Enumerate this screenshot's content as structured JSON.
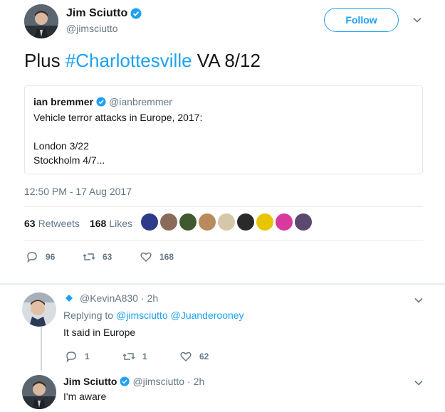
{
  "tweet": {
    "author_name": "Jim Sciutto",
    "author_handle": "@jimsciutto",
    "follow_label": "Follow",
    "text_prefix": "Plus ",
    "hashtag": "#Charlottesville",
    "text_suffix": " VA 8/12",
    "timestamp": "12:50 PM - 17 Aug 2017"
  },
  "quoted": {
    "author_name": "ian bremmer",
    "author_handle": "@ianbremmer",
    "lines": [
      "Vehicle terror attacks in Europe, 2017:",
      "London 3/22",
      "Stockholm 4/7..."
    ]
  },
  "stats": {
    "retweets_count": "63",
    "retweets_label": "Retweets",
    "likes_count": "168",
    "likes_label": "Likes"
  },
  "actions": {
    "replies": "96",
    "retweets": "63",
    "likes": "168"
  },
  "replies": [
    {
      "author_handle": "@KevinA830",
      "time": "2h",
      "replying_prefix": "Replying to",
      "replying_to_1": "@jimsciutto",
      "replying_to_2": "@Juanderooney",
      "text": "It said in Europe",
      "replies": "1",
      "retweets": "1",
      "likes": "62"
    },
    {
      "author_name": "Jim Sciutto",
      "author_handle": "@jimsciutto",
      "time": "2h",
      "text": "I'm aware"
    }
  ],
  "colors": {
    "accent": "#1da1f2",
    "secondary_text": "#657786",
    "border": "#e1e8ed"
  }
}
